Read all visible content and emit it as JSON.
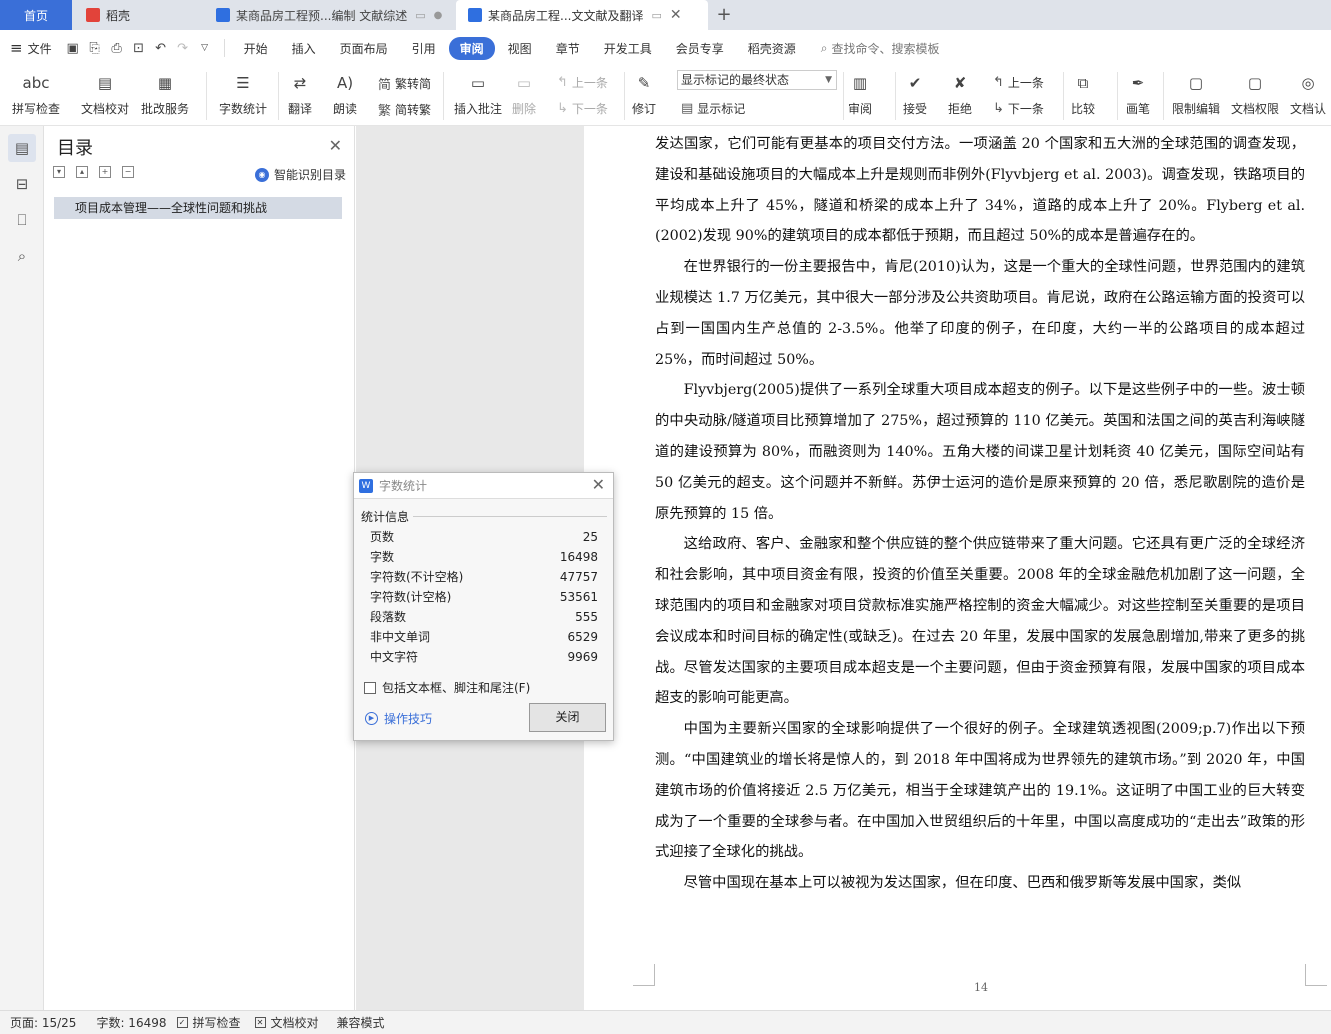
{
  "tabs": {
    "home": "首页",
    "daoke": "稻壳",
    "doc1": "某商品房工程预...编制 文献综述",
    "doc2": "某商品房工程...文文献及翻译",
    "close_symbol": "✕",
    "add_symbol": "+"
  },
  "menu": {
    "file": "文件",
    "tabs": [
      "开始",
      "插入",
      "页面布局",
      "引用",
      "审阅",
      "视图",
      "章节",
      "开发工具",
      "会员专享",
      "稻壳资源"
    ],
    "search_placeholder": "查找命令、搜索模板"
  },
  "ribbon": {
    "spell_check": "拼写检查",
    "doc_proofread": "文档校对",
    "revise_service": "批改服务",
    "word_count": "字数统计",
    "translate": "翻译",
    "read_aloud": "朗读",
    "to_simplified": "繁转简",
    "to_traditional": "简转繁",
    "insert_comment": "插入批注",
    "delete": "删除",
    "prev": "上一条",
    "next": "下一条",
    "revise": "修订",
    "markup_state": "显示标记的最终状态",
    "show_markup": "显示标记",
    "review": "审阅",
    "accept": "接受",
    "reject": "拒绝",
    "prev2": "上一条",
    "next2": "下一条",
    "compare": "比较",
    "ink": "画笔",
    "restrict_edit": "限制编辑",
    "doc_permission": "文档权限",
    "doc_auth": "文档认"
  },
  "toc": {
    "title": "目录",
    "smart": "智能识别目录",
    "item": "项目成本管理——全球性问题和挑战"
  },
  "document": {
    "paragraphs": [
      {
        "indent": false,
        "text": "发达国家，它们可能有更基本的项目交付方法。一项涵盖 20 个国家和五大洲的全球范围的调查发现，建设和基础设施项目的大幅成本上升是规则而非例外(Flyvbjerg et al. 2003)。调查发现，铁路项目的平均成本上升了 45%，隧道和桥梁的成本上升了 34%，道路的成本上升了 20%。Flyberg et al.(2002)发现 90%的建筑项目的成本都低于预期，而且超过 50%的成本是普遍存在的。"
      },
      {
        "indent": true,
        "text": "在世界银行的一份主要报告中，肯尼(2010)认为，这是一个重大的全球性问题，世界范围内的建筑业规模达 1.7 万亿美元，其中很大一部分涉及公共资助项目。肯尼说，政府在公路运输方面的投资可以占到一国国内生产总值的 2-3.5%。他举了印度的例子，在印度，大约一半的公路项目的成本超过 25%，而时间超过 50%。"
      },
      {
        "indent": true,
        "text": "Flyvbjerg(2005)提供了一系列全球重大项目成本超支的例子。以下是这些例子中的一些。波士顿的中央动脉/隧道项目比预算增加了 275%，超过预算的 110 亿美元。英国和法国之间的英吉利海峡隧道的建设预算为 80%，而融资则为 140%。五角大楼的间谍卫星计划耗资 40 亿美元，国际空间站有 50 亿美元的超支。这个问题并不新鲜。苏伊士运河的造价是原来预算的 20 倍，悉尼歌剧院的造价是原先预算的 15 倍。"
      },
      {
        "indent": true,
        "text": "这给政府、客户、金融家和整个供应链的整个供应链带来了重大问题。它还具有更广泛的全球经济和社会影响，其中项目资金有限，投资的价值至关重要。2008 年的全球金融危机加剧了这一问题，全球范围内的项目和金融家对项目贷款标准实施严格控制的资金大幅减少。对这些控制至关重要的是项目会议成本和时间目标的确定性(或缺乏)。在过去 20 年里，发展中国家的发展急剧增加,带来了更多的挑战。尽管发达国家的主要项目成本超支是一个主要问题，但由于资金预算有限，发展中国家的项目成本超支的影响可能更高。"
      },
      {
        "indent": true,
        "text": "中国为主要新兴国家的全球影响提供了一个很好的例子。全球建筑透视图(2009;p.7)作出以下预测。“中国建筑业的增长将是惊人的，到 2018 年中国将成为世界领先的建筑市场。”到 2020 年，中国建筑市场的价值将接近 2.5 万亿美元，相当于全球建筑产出的 19.1%。这证明了中国工业的巨大转变成为了一个重要的全球参与者。在中国加入世贸组织后的十年里，中国以高度成功的“走出去”政策的形式迎接了全球化的挑战。"
      },
      {
        "indent": true,
        "text": "尽管中国现在基本上可以被视为发达国家，但在印度、巴西和俄罗斯等发展中国家，类似"
      }
    ],
    "page_number": "14"
  },
  "dialog": {
    "title": "字数统计",
    "section": "统计信息",
    "rows": [
      {
        "label": "页数",
        "value": "25"
      },
      {
        "label": "字数",
        "value": "16498"
      },
      {
        "label": "字符数(不计空格)",
        "value": "47757"
      },
      {
        "label": "字符数(计空格)",
        "value": "53561"
      },
      {
        "label": "段落数",
        "value": "555"
      },
      {
        "label": "非中文单词",
        "value": "6529"
      },
      {
        "label": "中文字符",
        "value": "9969"
      }
    ],
    "include_label": "包括文本框、脚注和尾注(F)",
    "tips": "操作技巧",
    "close": "关闭"
  },
  "status": {
    "page": "页面: 15/25",
    "words": "字数: 16498",
    "spell": "拼写检查",
    "proof": "文档校对",
    "compat": "兼容模式"
  }
}
